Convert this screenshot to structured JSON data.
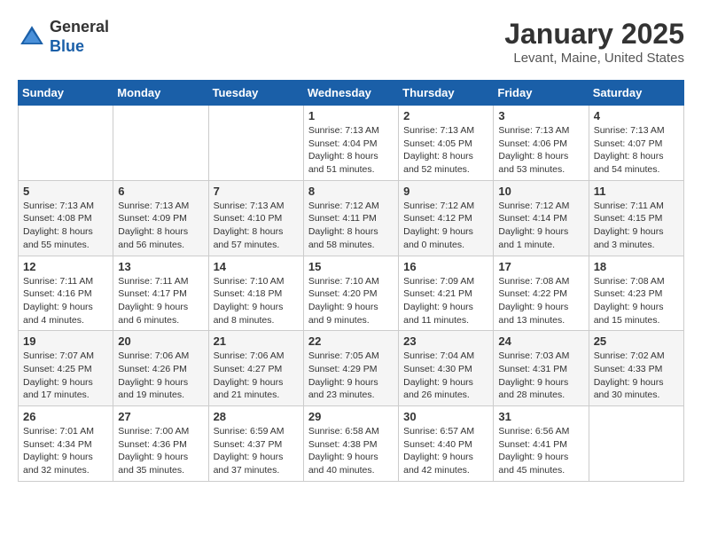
{
  "logo": {
    "general": "General",
    "blue": "Blue"
  },
  "title": "January 2025",
  "location": "Levant, Maine, United States",
  "days_of_week": [
    "Sunday",
    "Monday",
    "Tuesday",
    "Wednesday",
    "Thursday",
    "Friday",
    "Saturday"
  ],
  "weeks": [
    [
      {
        "day": "",
        "info": ""
      },
      {
        "day": "",
        "info": ""
      },
      {
        "day": "",
        "info": ""
      },
      {
        "day": "1",
        "info": "Sunrise: 7:13 AM\nSunset: 4:04 PM\nDaylight: 8 hours and 51 minutes."
      },
      {
        "day": "2",
        "info": "Sunrise: 7:13 AM\nSunset: 4:05 PM\nDaylight: 8 hours and 52 minutes."
      },
      {
        "day": "3",
        "info": "Sunrise: 7:13 AM\nSunset: 4:06 PM\nDaylight: 8 hours and 53 minutes."
      },
      {
        "day": "4",
        "info": "Sunrise: 7:13 AM\nSunset: 4:07 PM\nDaylight: 8 hours and 54 minutes."
      }
    ],
    [
      {
        "day": "5",
        "info": "Sunrise: 7:13 AM\nSunset: 4:08 PM\nDaylight: 8 hours and 55 minutes."
      },
      {
        "day": "6",
        "info": "Sunrise: 7:13 AM\nSunset: 4:09 PM\nDaylight: 8 hours and 56 minutes."
      },
      {
        "day": "7",
        "info": "Sunrise: 7:13 AM\nSunset: 4:10 PM\nDaylight: 8 hours and 57 minutes."
      },
      {
        "day": "8",
        "info": "Sunrise: 7:12 AM\nSunset: 4:11 PM\nDaylight: 8 hours and 58 minutes."
      },
      {
        "day": "9",
        "info": "Sunrise: 7:12 AM\nSunset: 4:12 PM\nDaylight: 9 hours and 0 minutes."
      },
      {
        "day": "10",
        "info": "Sunrise: 7:12 AM\nSunset: 4:14 PM\nDaylight: 9 hours and 1 minute."
      },
      {
        "day": "11",
        "info": "Sunrise: 7:11 AM\nSunset: 4:15 PM\nDaylight: 9 hours and 3 minutes."
      }
    ],
    [
      {
        "day": "12",
        "info": "Sunrise: 7:11 AM\nSunset: 4:16 PM\nDaylight: 9 hours and 4 minutes."
      },
      {
        "day": "13",
        "info": "Sunrise: 7:11 AM\nSunset: 4:17 PM\nDaylight: 9 hours and 6 minutes."
      },
      {
        "day": "14",
        "info": "Sunrise: 7:10 AM\nSunset: 4:18 PM\nDaylight: 9 hours and 8 minutes."
      },
      {
        "day": "15",
        "info": "Sunrise: 7:10 AM\nSunset: 4:20 PM\nDaylight: 9 hours and 9 minutes."
      },
      {
        "day": "16",
        "info": "Sunrise: 7:09 AM\nSunset: 4:21 PM\nDaylight: 9 hours and 11 minutes."
      },
      {
        "day": "17",
        "info": "Sunrise: 7:08 AM\nSunset: 4:22 PM\nDaylight: 9 hours and 13 minutes."
      },
      {
        "day": "18",
        "info": "Sunrise: 7:08 AM\nSunset: 4:23 PM\nDaylight: 9 hours and 15 minutes."
      }
    ],
    [
      {
        "day": "19",
        "info": "Sunrise: 7:07 AM\nSunset: 4:25 PM\nDaylight: 9 hours and 17 minutes."
      },
      {
        "day": "20",
        "info": "Sunrise: 7:06 AM\nSunset: 4:26 PM\nDaylight: 9 hours and 19 minutes."
      },
      {
        "day": "21",
        "info": "Sunrise: 7:06 AM\nSunset: 4:27 PM\nDaylight: 9 hours and 21 minutes."
      },
      {
        "day": "22",
        "info": "Sunrise: 7:05 AM\nSunset: 4:29 PM\nDaylight: 9 hours and 23 minutes."
      },
      {
        "day": "23",
        "info": "Sunrise: 7:04 AM\nSunset: 4:30 PM\nDaylight: 9 hours and 26 minutes."
      },
      {
        "day": "24",
        "info": "Sunrise: 7:03 AM\nSunset: 4:31 PM\nDaylight: 9 hours and 28 minutes."
      },
      {
        "day": "25",
        "info": "Sunrise: 7:02 AM\nSunset: 4:33 PM\nDaylight: 9 hours and 30 minutes."
      }
    ],
    [
      {
        "day": "26",
        "info": "Sunrise: 7:01 AM\nSunset: 4:34 PM\nDaylight: 9 hours and 32 minutes."
      },
      {
        "day": "27",
        "info": "Sunrise: 7:00 AM\nSunset: 4:36 PM\nDaylight: 9 hours and 35 minutes."
      },
      {
        "day": "28",
        "info": "Sunrise: 6:59 AM\nSunset: 4:37 PM\nDaylight: 9 hours and 37 minutes."
      },
      {
        "day": "29",
        "info": "Sunrise: 6:58 AM\nSunset: 4:38 PM\nDaylight: 9 hours and 40 minutes."
      },
      {
        "day": "30",
        "info": "Sunrise: 6:57 AM\nSunset: 4:40 PM\nDaylight: 9 hours and 42 minutes."
      },
      {
        "day": "31",
        "info": "Sunrise: 6:56 AM\nSunset: 4:41 PM\nDaylight: 9 hours and 45 minutes."
      },
      {
        "day": "",
        "info": ""
      }
    ]
  ]
}
